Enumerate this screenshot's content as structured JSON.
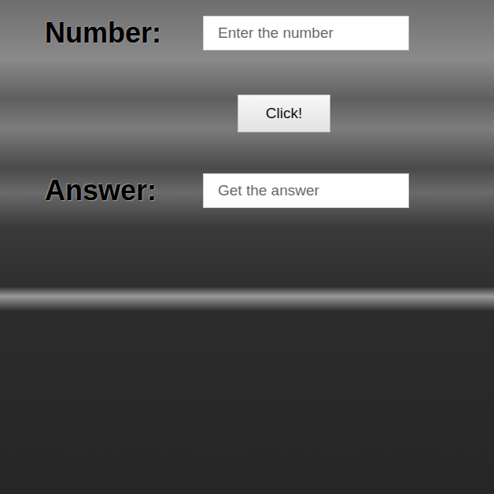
{
  "form": {
    "number": {
      "label": "Number:",
      "placeholder": "Enter the number"
    },
    "button": {
      "label": "Click!"
    },
    "answer": {
      "label": "Answer:",
      "placeholder": "Get the answer"
    }
  }
}
